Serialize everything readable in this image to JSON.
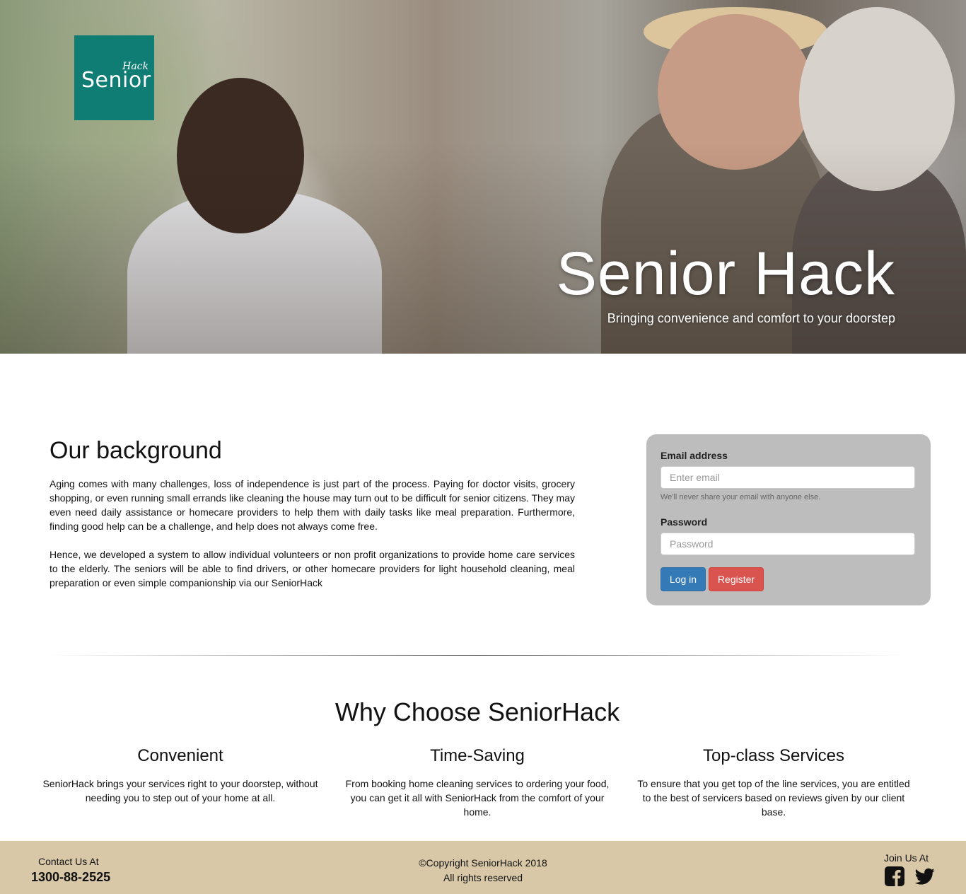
{
  "hero": {
    "logo_main": "Senior",
    "logo_sub": "Hack",
    "title": "Senior Hack",
    "subtitle": "Bringing convenience and comfort to your doorstep"
  },
  "background": {
    "title": "Our background",
    "paragraphs": [
      "Aging comes with many challenges, loss of independence is just part of the process. Paying for doctor visits, grocery shopping, or even running small errands like cleaning the house may turn out to be difficult for senior citizens. They may even need daily assistance or homecare providers to help them with daily tasks like meal preparation. Furthermore, finding good help can be a challenge, and help does not always come free.",
      "Hence, we developed a system to allow individual volunteers or non profit organizations to provide home care services to the elderly. The seniors will be able to find drivers, or other homecare providers for light household cleaning, meal preparation or even simple companionship via our SeniorHack"
    ]
  },
  "login": {
    "email_label": "Email address",
    "email_placeholder": "Enter email",
    "email_value": "",
    "email_help": "We'll never share your email with anyone else.",
    "password_label": "Password",
    "password_placeholder": "Password",
    "password_value": "",
    "login_button": "Log in",
    "register_button": "Register",
    "colors": {
      "card": "#bdbdbd",
      "login": "#337ab7",
      "register": "#d9534f"
    }
  },
  "why": {
    "title": "Why Choose SeniorHack",
    "features": [
      {
        "title": "Convenient",
        "description": "SeniorHack brings your services right to your doorstep, without needing you to step out of your home at all."
      },
      {
        "title": "Time-Saving",
        "description": "From booking home cleaning services to ordering your food, you can get it all with SeniorHack from the comfort of your home."
      },
      {
        "title": "Top-class Services",
        "description": "To ensure that you get top of the line services, you are entitled to the best of servicers based on reviews given by our client base."
      }
    ]
  },
  "footer": {
    "contact_label": "Contact Us At",
    "phone": "1300-88-2525",
    "copyright_line1": "©Copyright SeniorHack 2018",
    "copyright_line2": "All rights reserved",
    "join_label": "Join Us At",
    "social_icons": [
      "facebook-icon",
      "twitter-icon"
    ],
    "background_color": "#d8c8a8"
  },
  "colors": {
    "logo_teal": "#0f7d74"
  }
}
